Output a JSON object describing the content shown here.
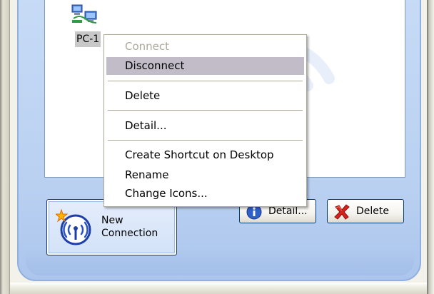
{
  "connection_item": {
    "label": "PC-1"
  },
  "context_menu": {
    "items": [
      {
        "label": "Connect",
        "enabled": false
      },
      {
        "label": "Disconnect",
        "enabled": true,
        "highlighted": true
      },
      {
        "label": "Delete",
        "enabled": true
      },
      {
        "label": "Detail...",
        "enabled": true
      },
      {
        "label": "Create Shortcut on Desktop",
        "enabled": true
      },
      {
        "label": "Rename",
        "enabled": true
      },
      {
        "label": "Change Icons...",
        "enabled": true
      }
    ]
  },
  "buttons": {
    "new_connection_line1": "New",
    "new_connection_line2": "Connection",
    "detail": "Detail...",
    "delete": "Delete"
  },
  "icons": {
    "new_connection": "wireless-antenna-icon",
    "detail": "info-icon",
    "delete": "red-x-icon",
    "item": "network-computers-icon"
  },
  "colors": {
    "panel": "#b9d0f1",
    "menu_highlight": "#c2bcc8",
    "menu_disabled": "#aca899",
    "button_border": "#003c74"
  }
}
